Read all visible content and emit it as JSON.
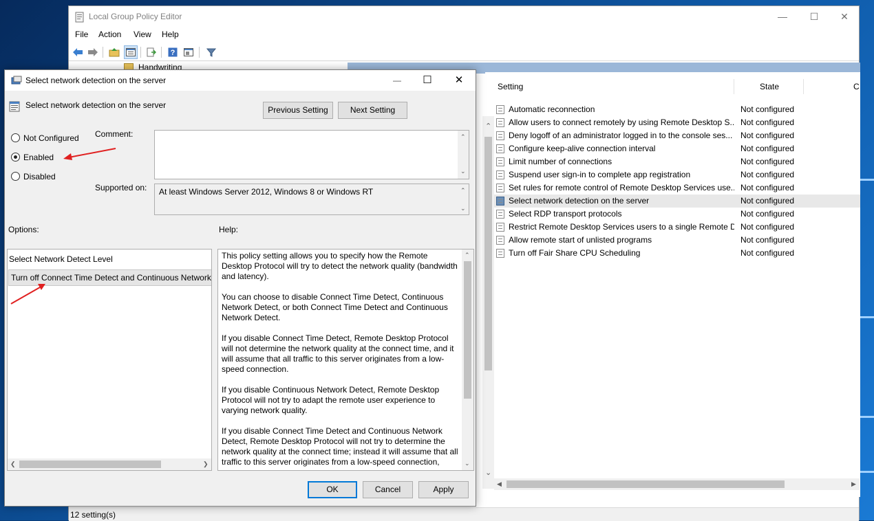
{
  "window": {
    "title": "Local Group Policy Editor",
    "menu": [
      "File",
      "Action",
      "View",
      "Help"
    ],
    "tree_item": "Handwriting"
  },
  "settings_table": {
    "headers": {
      "setting": "Setting",
      "state": "State",
      "comment": "C"
    },
    "rows": [
      {
        "name": "Automatic reconnection",
        "state": "Not configured"
      },
      {
        "name": "Allow users to connect remotely by using Remote Desktop S...",
        "state": "Not configured"
      },
      {
        "name": "Deny logoff of an administrator logged in to the console ses...",
        "state": "Not configured"
      },
      {
        "name": "Configure keep-alive connection interval",
        "state": "Not configured"
      },
      {
        "name": "Limit number of connections",
        "state": "Not configured"
      },
      {
        "name": "Suspend user sign-in to complete app registration",
        "state": "Not configured"
      },
      {
        "name": "Set rules for remote control of Remote Desktop Services use...",
        "state": "Not configured"
      },
      {
        "name": "Select network detection on the server",
        "state": "Not configured",
        "selected": true
      },
      {
        "name": "Select RDP transport protocols",
        "state": "Not configured"
      },
      {
        "name": "Restrict Remote Desktop Services users to a single Remote D...",
        "state": "Not configured"
      },
      {
        "name": "Allow remote start of unlisted programs",
        "state": "Not configured"
      },
      {
        "name": "Turn off Fair Share CPU Scheduling",
        "state": "Not configured"
      }
    ]
  },
  "status": "12 setting(s)",
  "dialog": {
    "title": "Select network detection on the server",
    "policy_name": "Select network detection on the server",
    "prev_button": "Previous Setting",
    "next_button": "Next Setting",
    "radios": [
      {
        "label": "Not Configured",
        "checked": false
      },
      {
        "label": "Enabled",
        "checked": true
      },
      {
        "label": "Disabled",
        "checked": false
      }
    ],
    "comment_label": "Comment:",
    "supported_label": "Supported on:",
    "supported_value": "At least Windows Server 2012, Windows 8 or Windows RT",
    "options_label": "Options:",
    "help_label": "Help:",
    "option_title": "Select Network Detect Level",
    "option_value": "Turn off Connect Time Detect and Continuous Network",
    "help_paragraphs": [
      "This policy setting allows you to specify how the Remote Desktop Protocol will try to detect the network quality (bandwidth and latency).",
      "You can choose to disable Connect Time Detect, Continuous Network Detect, or both Connect Time Detect and Continuous Network Detect.",
      "If you disable Connect Time Detect, Remote Desktop Protocol will not determine the network quality at the connect time, and it will assume that all traffic to this server originates from a low-speed connection.",
      "If you disable Continuous Network Detect, Remote Desktop Protocol will not try to adapt the remote user experience to varying network quality.",
      "If you disable Connect Time Detect and Continuous Network Detect, Remote Desktop Protocol will not try to determine the network quality at the connect time; instead it will assume that all traffic to this server originates from a low-speed connection,"
    ],
    "ok_button": "OK",
    "cancel_button": "Cancel",
    "apply_button": "Apply"
  },
  "colors": {
    "accent_blue": "#0078d7",
    "arrow_red": "#e02020",
    "selection_gray": "#e8e8e8"
  }
}
